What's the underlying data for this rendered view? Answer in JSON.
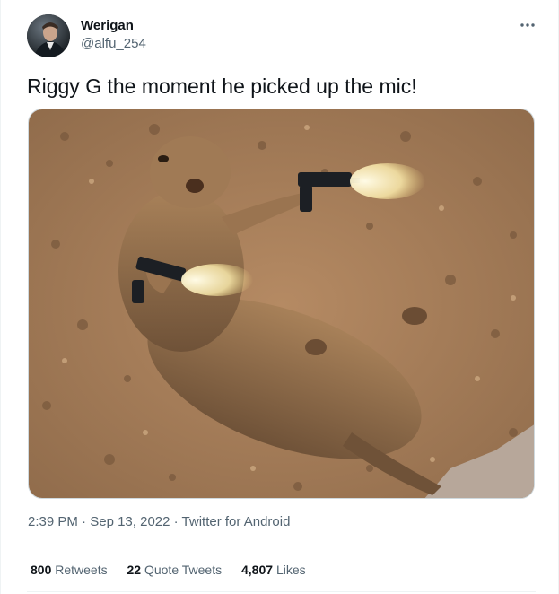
{
  "tweet": {
    "author": {
      "display_name": "Werigan",
      "handle": "@alfu_254"
    },
    "text": "Riggy G the moment he picked up the mic!",
    "media": {
      "icon": "photo-of-prairie-dog-holding-two-pistols"
    },
    "meta": {
      "time": "2:39 PM",
      "date": "Sep 13, 2022",
      "source": "Twitter for Android",
      "separator": " · "
    },
    "stats": {
      "retweets_count": "800",
      "retweets_label": "Retweets",
      "quotes_count": "22",
      "quotes_label": "Quote Tweets",
      "likes_count": "4,807",
      "likes_label": "Likes"
    }
  },
  "colors": {
    "text_primary": "#0f1419",
    "text_secondary": "#536471",
    "divider": "#eff3f4"
  }
}
